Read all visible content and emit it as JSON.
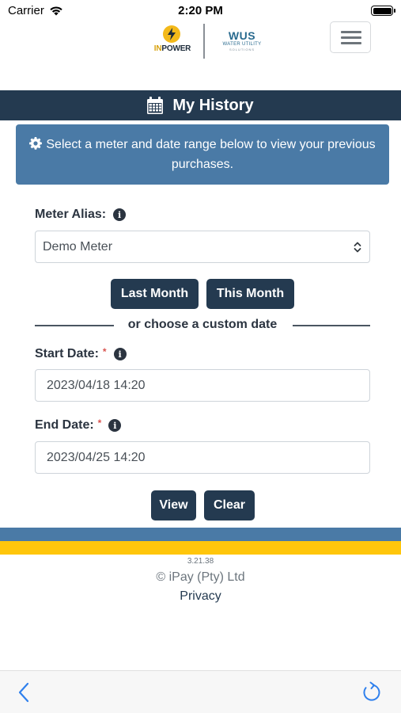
{
  "status_bar": {
    "carrier": "Carrier",
    "time": "2:20 PM"
  },
  "header": {
    "logo_inpower": {
      "prefix": "IN",
      "suffix": "POWER"
    },
    "logo_wus": {
      "mark": "WUS",
      "line1": "WATER UTILITY",
      "line2": "SOLUTIONS"
    }
  },
  "title_bar": {
    "icon": "calendar-icon",
    "title": "My History"
  },
  "info_panel": {
    "icon": "gear-icon",
    "text": "Select a meter and date range below to view your previous purchases."
  },
  "form": {
    "meter_alias": {
      "label": "Meter Alias:",
      "value": "Demo Meter"
    },
    "quick_buttons": {
      "last_month": "Last Month",
      "this_month": "This Month"
    },
    "divider_text": "or choose a custom date",
    "start_date": {
      "label": "Start Date:",
      "required_mark": "*",
      "value": "2023/04/18 14:20"
    },
    "end_date": {
      "label": "End Date:",
      "required_mark": "*",
      "value": "2023/04/25 14:20"
    },
    "actions": {
      "view": "View",
      "clear": "Clear"
    }
  },
  "footer": {
    "version": "3.21.38",
    "copyright": "© iPay (Pty) Ltd",
    "privacy": "Privacy"
  },
  "colors": {
    "navy": "#243a50",
    "blue": "#4a7aa6",
    "yellow": "#ffc60b",
    "required": "#d9534f"
  },
  "browser_bar": {
    "back_icon": "chevron-left-icon",
    "reload_icon": "reload-icon"
  }
}
